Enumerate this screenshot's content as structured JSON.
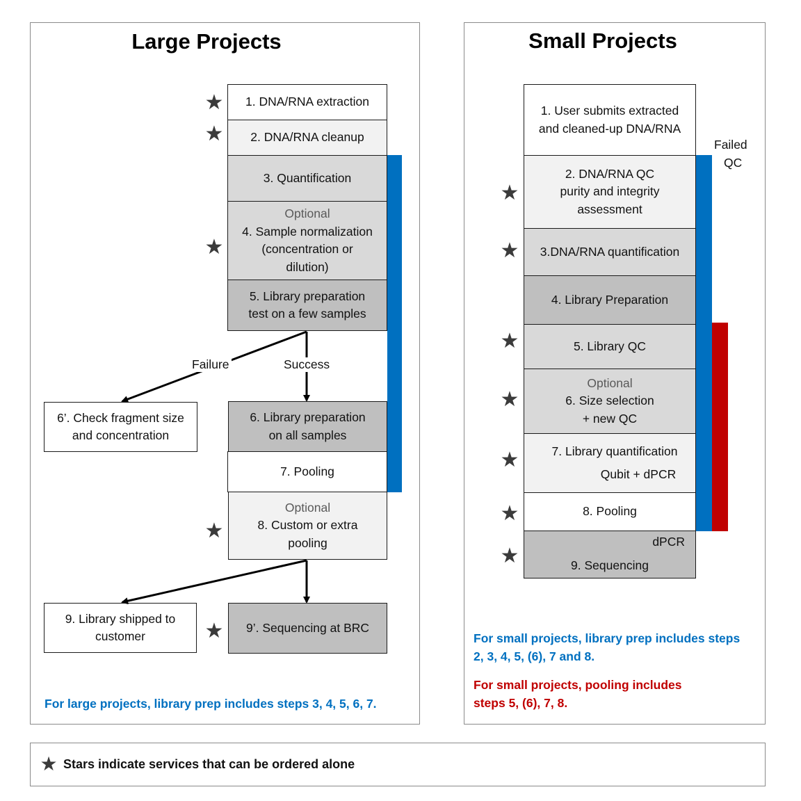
{
  "large": {
    "title": "Large Projects",
    "steps": {
      "s1": "1. DNA/RNA extraction",
      "s2": "2. DNA/RNA cleanup",
      "s3": "3. Quantification",
      "s4_optional": "Optional",
      "s4_l1": "4. Sample normalization",
      "s4_l2": "(concentration or",
      "s4_l3": "dilution)",
      "s5_l1": "5. Library preparation",
      "s5_l2": "test on a few samples",
      "s6p_l1": "6’. Check fragment size",
      "s6p_l2": "and concentration",
      "s6_l1": "6. Library preparation",
      "s6_l2": "on all samples",
      "s7": "7. Pooling",
      "s8_optional": "Optional",
      "s8_l1": "8. Custom or extra",
      "s8_l2": "pooling",
      "s9_l1": "9. Library shipped to",
      "s9_l2": "customer",
      "s9p": "9’. Sequencing at BRC"
    },
    "failure_label": "Failure",
    "success_label": "Success",
    "note": "For large projects, library prep includes steps 3, 4, 5, 6, 7."
  },
  "small": {
    "title": "Small Projects",
    "steps": {
      "s1_l1": "1. User submits extracted",
      "s1_l2": "and cleaned-up  DNA/RNA",
      "s2_l1": "2. DNA/RNA QC",
      "s2_l2": "purity and integrity",
      "s2_l3": "assessment",
      "s3": "3.DNA/RNA quantification",
      "s4": "4. Library Preparation",
      "s5": "5. Library QC",
      "s6_optional": "Optional",
      "s6_l1": "6. Size selection",
      "s6_l2": "+ new QC",
      "s7_l1": "7. Library quantification",
      "s7_l2": "Qubit + dPCR",
      "s8": "8. Pooling",
      "s9_dpcr": "dPCR",
      "s9": "9. Sequencing"
    },
    "failed_qc_l1": "Failed",
    "failed_qc_l2": "QC",
    "note_blue_l1": "For small projects, library prep includes steps",
    "note_blue_l2": "2, 3, 4, 5, (6), 7 and 8.",
    "note_red_l1": "For small projects, pooling includes",
    "note_red_l2": "steps 5, (6), 7, 8."
  },
  "legend": {
    "star_glyph": "★",
    "text": "Stars indicate services that can be ordered alone"
  },
  "icons": {
    "star": "★"
  },
  "colors": {
    "library_prep_bar": "#0070c0",
    "pooling_bar": "#c00000",
    "note_blue": "#0070c0",
    "note_red": "#c00000",
    "star": "#3b3b3b"
  }
}
